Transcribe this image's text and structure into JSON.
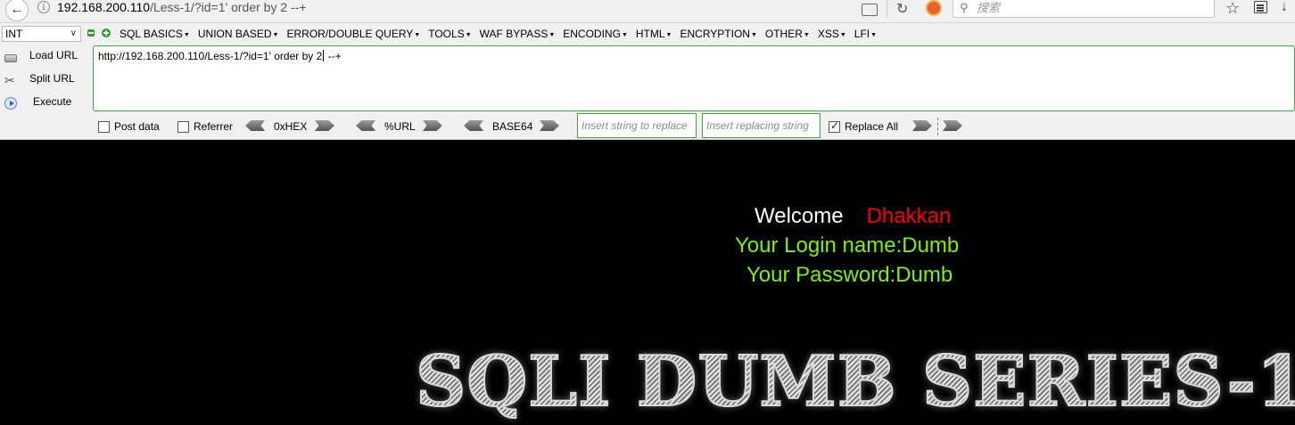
{
  "browser": {
    "url_host": "192.168.200.110",
    "url_path": "/Less-1/?id=1' order by 2 --+",
    "search_placeholder": "搜索"
  },
  "hackbar": {
    "mode_select": "INT",
    "menu": [
      "SQL BASICS",
      "UNION BASED",
      "ERROR/DOUBLE QUERY",
      "TOOLS",
      "WAF BYPASS",
      "ENCODING",
      "HTML",
      "ENCRYPTION",
      "OTHER",
      "XSS",
      "LFI"
    ],
    "load_url": "Load URL",
    "split_url": "Split URL",
    "execute": "Execute",
    "url_text_before_caret": "http://192.168.200.110/Less-1/?id=1' order by 2",
    "url_text_after_caret": " --+",
    "post_data": "Post data",
    "referrer": "Referrer",
    "hex": "0xHEX",
    "url_enc": "%URL",
    "base64": "BASE64",
    "insert_replace_placeholder": "Insert string to replace",
    "insert_replacing_placeholder": "Insert replacing string",
    "replace_all": "Replace All",
    "replace_all_checked": true
  },
  "page": {
    "welcome": "Welcome",
    "user_name": "Dhakkan",
    "login_line": "Your Login name:Dumb",
    "password_line": "Your Password:Dumb",
    "banner": "SQLI DUMB SERIES-1"
  }
}
